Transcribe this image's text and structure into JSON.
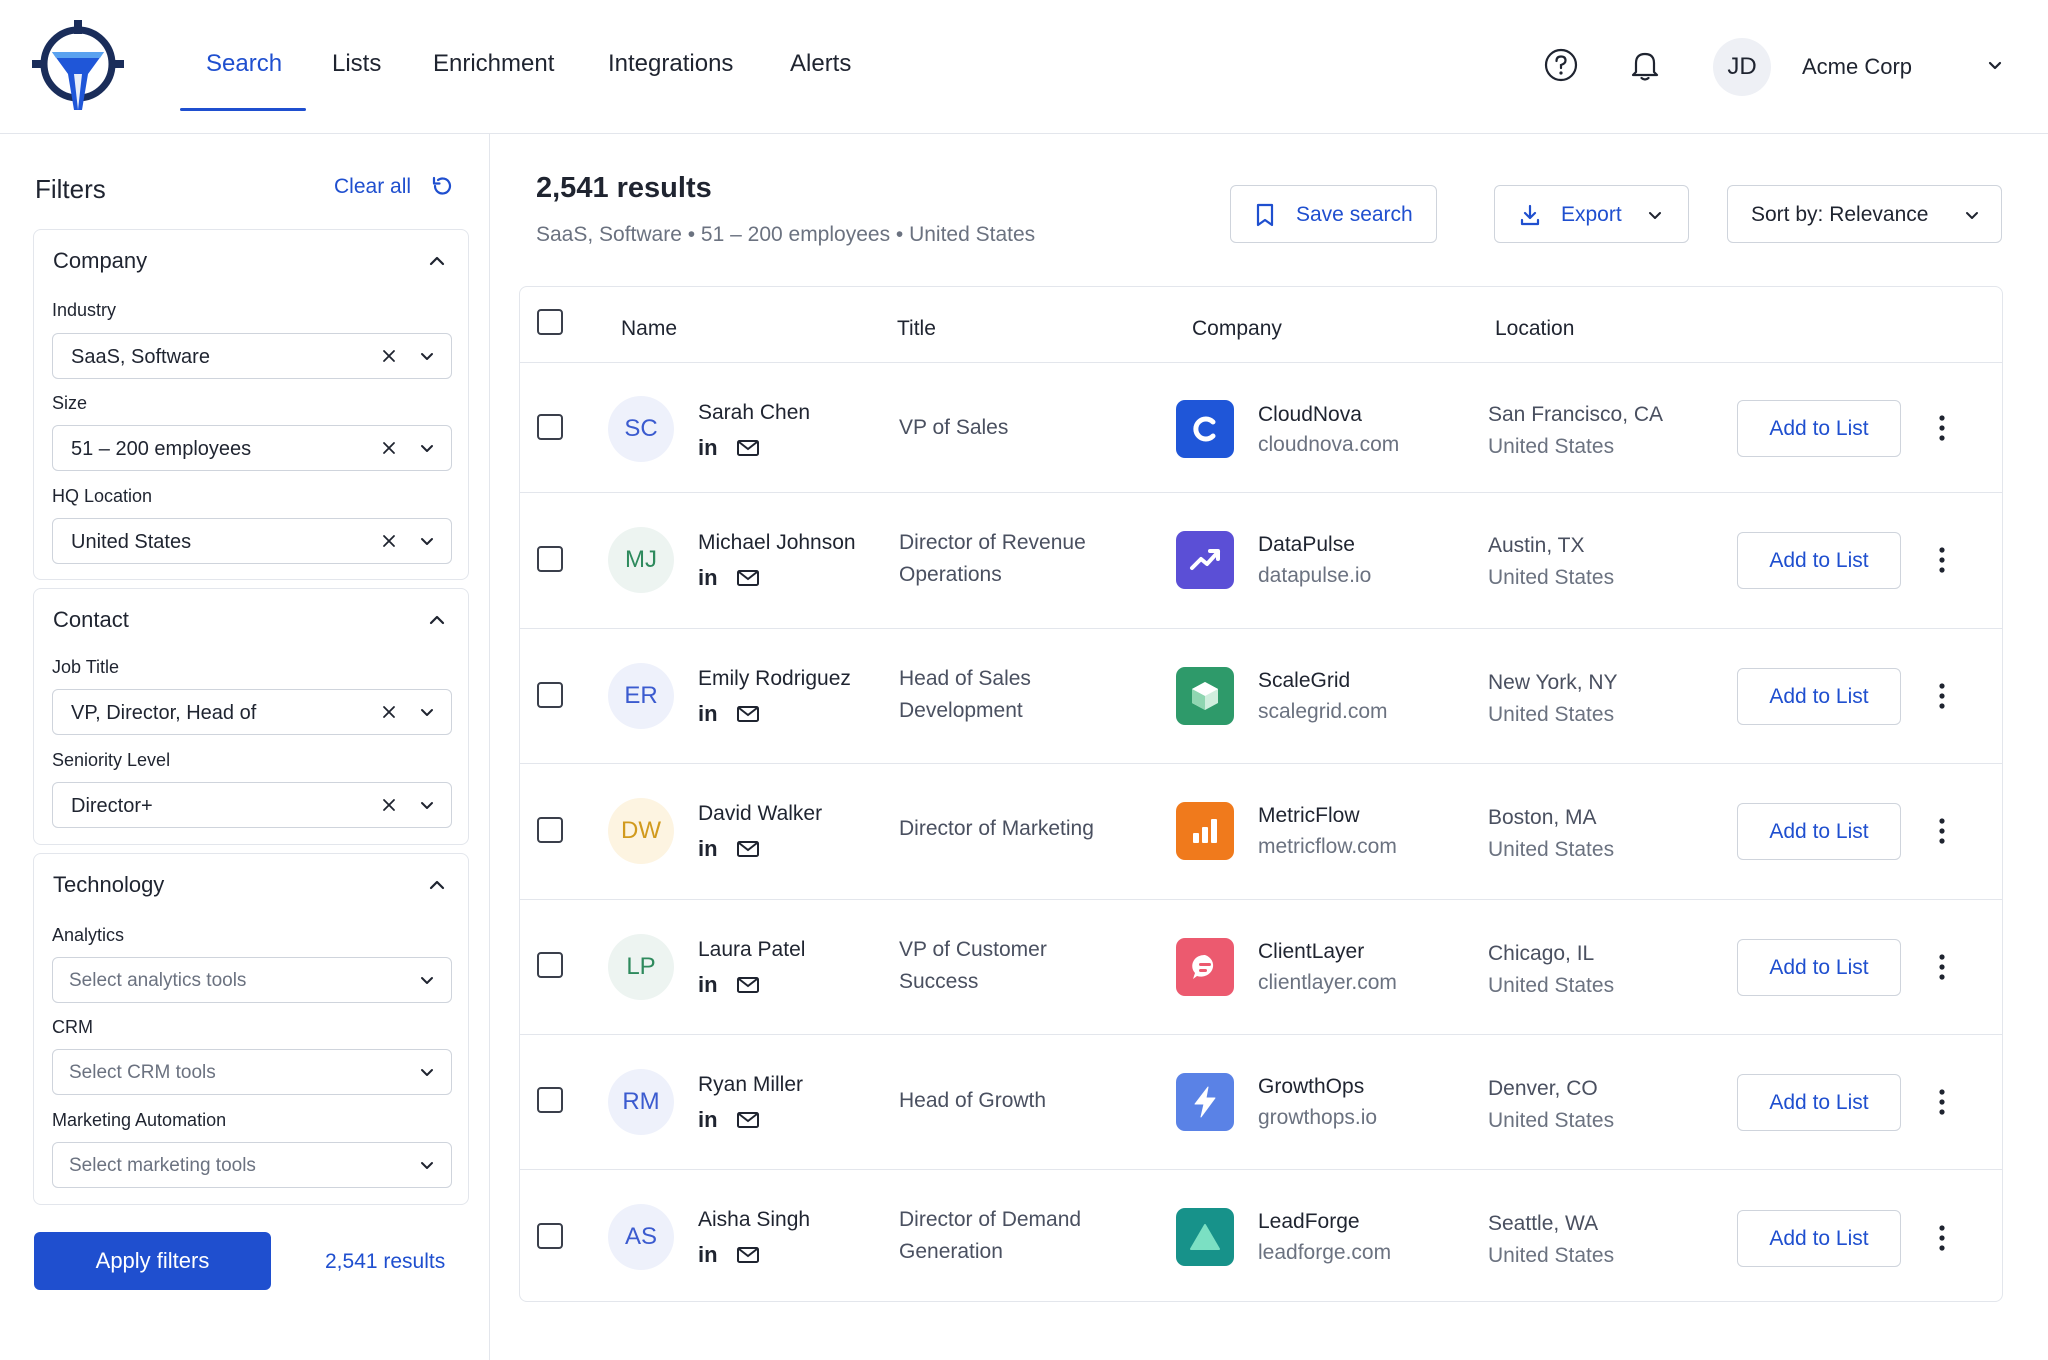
{
  "nav": {
    "items": [
      "Search",
      "Lists",
      "Enrichment",
      "Integrations",
      "Alerts"
    ],
    "active": "Search"
  },
  "user": {
    "initials": "JD",
    "org": "Acme Corp"
  },
  "sidebar": {
    "title": "Filters",
    "clear_all": "Clear all",
    "groups": {
      "company": {
        "title": "Company",
        "industry": {
          "label": "Industry",
          "value": "SaaS, Software"
        },
        "size": {
          "label": "Size",
          "value": "51 – 200 employees"
        },
        "hq": {
          "label": "HQ Location",
          "value": "United States"
        }
      },
      "contact": {
        "title": "Contact",
        "job_title": {
          "label": "Job Title",
          "value": "VP, Director, Head of"
        },
        "seniority": {
          "label": "Seniority Level",
          "value": "Director+"
        }
      },
      "technology": {
        "title": "Technology",
        "analytics": {
          "label": "Analytics",
          "placeholder": "Select analytics tools"
        },
        "crm": {
          "label": "CRM",
          "placeholder": "Select CRM tools"
        },
        "marketing": {
          "label": "Marketing Automation",
          "placeholder": "Select marketing tools"
        }
      }
    },
    "apply_label": "Apply filters",
    "results_count": "2,541 results"
  },
  "main": {
    "results_title": "2,541 results",
    "results_sub": "SaaS, Software • 51 – 200 employees • United States",
    "save_search": "Save search",
    "export": "Export",
    "sort": "Sort by: Relevance",
    "columns": {
      "name": "Name",
      "title": "Title",
      "company": "Company",
      "location": "Location"
    },
    "add_label": "Add to List",
    "rows": [
      {
        "initials": "SC",
        "name": "Sarah Chen",
        "title": "VP of Sales",
        "company": "CloudNova",
        "domain": "cloudnova.com",
        "city": "San Francisco, CA",
        "country": "United States"
      },
      {
        "initials": "MJ",
        "name": "Michael Johnson",
        "title": "Director of Revenue Operations",
        "company": "DataPulse",
        "domain": "datapulse.io",
        "city": "Austin, TX",
        "country": "United States"
      },
      {
        "initials": "ER",
        "name": "Emily Rodriguez",
        "title": "Head of Sales Development",
        "company": "ScaleGrid",
        "domain": "scalegrid.com",
        "city": "New York, NY",
        "country": "United States"
      },
      {
        "initials": "DW",
        "name": "David Walker",
        "title": "Director of Marketing",
        "company": "MetricFlow",
        "domain": "metricflow.com",
        "city": "Boston, MA",
        "country": "United States"
      },
      {
        "initials": "LP",
        "name": "Laura Patel",
        "title": "VP of Customer Success",
        "company": "ClientLayer",
        "domain": "clientlayer.com",
        "city": "Chicago, IL",
        "country": "United States"
      },
      {
        "initials": "RM",
        "name": "Ryan Miller",
        "title": "Head of Growth",
        "company": "GrowthOps",
        "domain": "growthops.io",
        "city": "Denver, CO",
        "country": "United States"
      },
      {
        "initials": "AS",
        "name": "Aisha Singh",
        "title": "Director of Demand Generation",
        "company": "LeadForge",
        "domain": "leadforge.com",
        "city": "Seattle, WA",
        "country": "United States"
      }
    ]
  },
  "colors": {
    "accent": "#1f4fcf",
    "cloudnova": "#1f56d8",
    "datapulse": "#5b4fd6",
    "scalegrid": "#2e9a6a",
    "metricflow": "#f07a1c",
    "clientlayer": "#ec5a6f",
    "growthops": "#5a82e6",
    "leadforge": "#17928a"
  },
  "icons": {
    "help": "help-circle-icon",
    "notifications": "bell-icon",
    "linkedin": "linkedin-icon",
    "email": "mail-icon",
    "more": "kebab-menu-icon",
    "save": "bookmark-icon",
    "export": "download-icon",
    "reset": "reset-icon"
  }
}
